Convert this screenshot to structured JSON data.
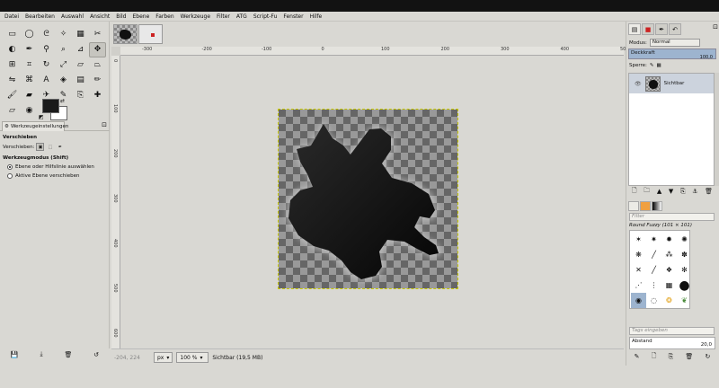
{
  "menu": [
    "Datei",
    "Bearbeiten",
    "Auswahl",
    "Ansicht",
    "Bild",
    "Ebene",
    "Farben",
    "Werkzeuge",
    "Filter",
    "ATG",
    "Script-Fu",
    "Fenster",
    "Hilfe"
  ],
  "toolbox": {
    "tools": [
      {
        "name": "rect-select-icon",
        "glyph": "▭"
      },
      {
        "name": "ellipse-select-icon",
        "glyph": "◯"
      },
      {
        "name": "lasso-icon",
        "glyph": "ᘓ"
      },
      {
        "name": "fuzzy-select-icon",
        "glyph": "✧"
      },
      {
        "name": "color-select-icon",
        "glyph": "▦"
      },
      {
        "name": "scissors-icon",
        "glyph": "✂"
      },
      {
        "name": "foreground-select-icon",
        "glyph": "◐"
      },
      {
        "name": "paths-icon",
        "glyph": "✒"
      },
      {
        "name": "color-picker-icon",
        "glyph": "⚲"
      },
      {
        "name": "zoom-icon",
        "glyph": "⌕"
      },
      {
        "name": "measure-icon",
        "glyph": "⊿"
      },
      {
        "name": "move-icon",
        "glyph": "✥"
      },
      {
        "name": "align-icon",
        "glyph": "⊞"
      },
      {
        "name": "crop-icon",
        "glyph": "⌗"
      },
      {
        "name": "rotate-icon",
        "glyph": "↻"
      },
      {
        "name": "scale-icon",
        "glyph": "⤢"
      },
      {
        "name": "shear-icon",
        "glyph": "▱"
      },
      {
        "name": "perspective-icon",
        "glyph": "⏢"
      },
      {
        "name": "flip-icon",
        "glyph": "⇋"
      },
      {
        "name": "cage-icon",
        "glyph": "⌘"
      },
      {
        "name": "text-icon",
        "glyph": "A"
      },
      {
        "name": "bucket-fill-icon",
        "glyph": "◈"
      },
      {
        "name": "gradient-icon",
        "glyph": "▤"
      },
      {
        "name": "pencil-icon",
        "glyph": "✏"
      },
      {
        "name": "paintbrush-icon",
        "glyph": "🖌"
      },
      {
        "name": "eraser-icon",
        "glyph": "▰"
      },
      {
        "name": "airbrush-icon",
        "glyph": "✈"
      },
      {
        "name": "ink-icon",
        "glyph": "✎"
      },
      {
        "name": "clone-icon",
        "glyph": "⎘"
      },
      {
        "name": "heal-icon",
        "glyph": "✚"
      },
      {
        "name": "perspective-clone-icon",
        "glyph": "⏥"
      },
      {
        "name": "blur-icon",
        "glyph": "◉"
      },
      {
        "name": "smudge-icon",
        "glyph": "☝"
      },
      {
        "name": "dodge-burn-icon",
        "glyph": "●"
      }
    ],
    "selected_tool_index": 11,
    "colors": {
      "foreground": "#1a1a1a",
      "background": "#ffffff"
    }
  },
  "tool_options": {
    "tab_label": "Werkzeugeinstellungen",
    "title": "Verschieben",
    "move_label": "Verschieben:",
    "mode_title": "Werkzeugmodus (Shift)",
    "option1": "Ebene oder Hilfslinie auswählen",
    "option2": "Aktive Ebene verschieben"
  },
  "ruler": {
    "h_ticks": [
      "-300",
      "-200",
      "-100",
      "0",
      "100",
      "200",
      "300",
      "400",
      "500",
      "600",
      "700"
    ],
    "v_ticks": [
      "0",
      "100",
      "200",
      "300",
      "400",
      "500",
      "600"
    ]
  },
  "status": {
    "coords": "-204, 224",
    "unit": "px",
    "zoom": "100 %",
    "layer_info": "Sichtbar (19,5 MB)"
  },
  "layers_panel": {
    "mode_label": "Modus:",
    "mode_value": "Normal",
    "opacity_label": "Deckkraft",
    "opacity_value": "100,0",
    "lock_label": "Sperre:",
    "layer_name": "Sichtbar"
  },
  "brushes_panel": {
    "filter_placeholder": "Filter",
    "brush_name": "Round Fuzzy (101 × 101)",
    "tags_placeholder": "Tags eingeben",
    "spacing_label": "Abstand",
    "spacing_value": "20,0"
  }
}
